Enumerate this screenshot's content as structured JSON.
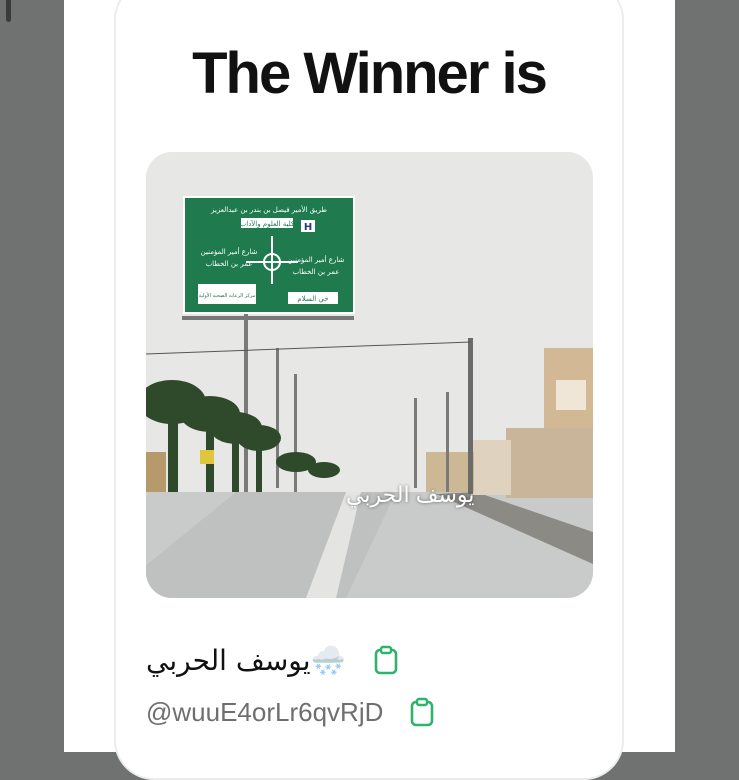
{
  "title": "The Winner is",
  "photo": {
    "watermark": "يوسف الحربي",
    "sign_lines": [
      "طريق الأمير فيصل بن بندر بن عبدالعزيز",
      "كلية العلوم والآداب",
      "شارع أمير المؤمنين",
      "عمر بن الخطاب",
      "شارع أمير المؤمنين",
      "عمر بن الخطاب",
      "مركز الرعاية الصحية الأولية",
      "حي السلام"
    ]
  },
  "winner": {
    "name": "يوسف الحربي",
    "emoji": "🌨️",
    "handle": "@wuuE4orLr6qvRjD"
  },
  "icons": {
    "copy_name": "clipboard-icon",
    "copy_handle": "clipboard-icon"
  },
  "colors": {
    "accent": "#2fb36b",
    "title": "#111111",
    "handle": "#6f6f6f"
  }
}
